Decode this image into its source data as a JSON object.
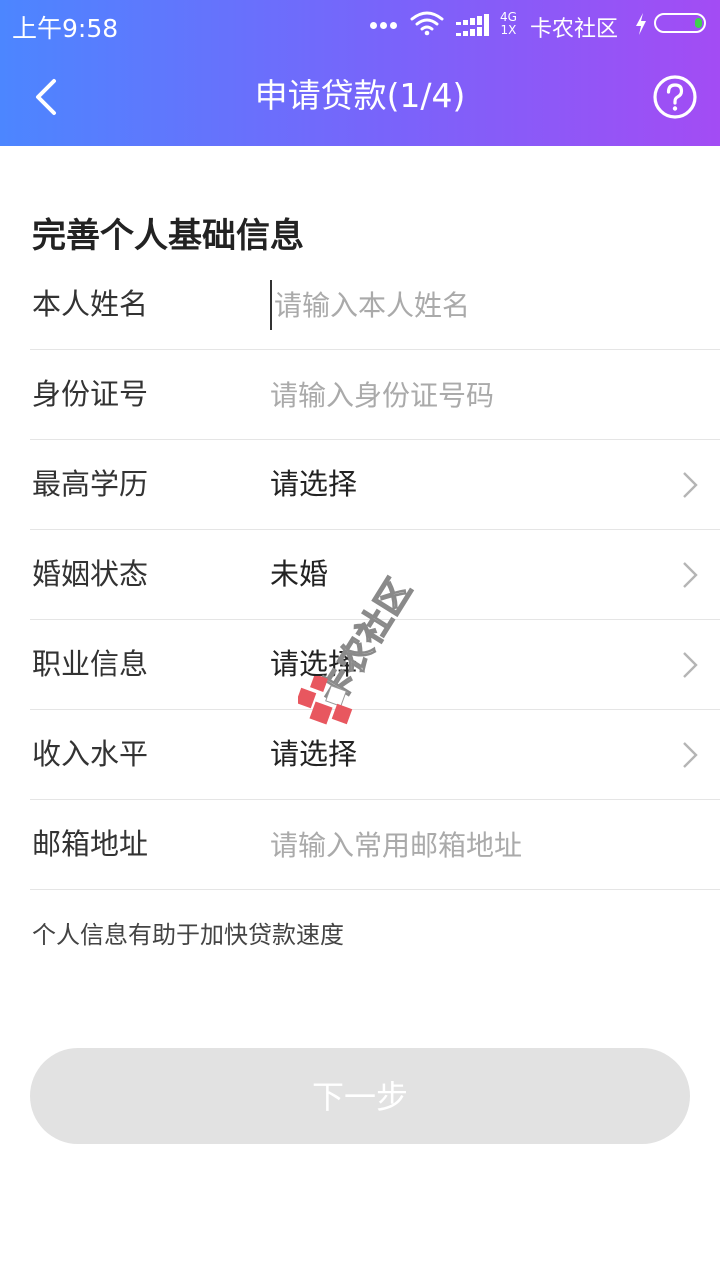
{
  "status_bar": {
    "time": "上午9:58",
    "network_top": "4G",
    "network_bottom": "1X",
    "carrier": "卡农社区",
    "battery_color": "#3ed04d"
  },
  "header": {
    "title": "申请贷款(1/4)",
    "back_icon": "chevron-left-icon",
    "help_icon": "question-circle-icon",
    "gradient": [
      "#4c86ff",
      "#a34cf4"
    ]
  },
  "section": {
    "title": "完善个人基础信息"
  },
  "form": {
    "name": {
      "label": "本人姓名",
      "placeholder": "请输入本人姓名"
    },
    "id_number": {
      "label": "身份证号",
      "placeholder": "请输入身份证号码"
    },
    "education": {
      "label": "最高学历",
      "value": "请选择"
    },
    "marital": {
      "label": "婚姻状态",
      "value": "未婚"
    },
    "occupation": {
      "label": "职业信息",
      "value": "请选择"
    },
    "income": {
      "label": "收入水平",
      "value": "请选择"
    },
    "email": {
      "label": "邮箱地址",
      "placeholder": "请输入常用邮箱地址"
    }
  },
  "hint": "个人信息有助于加快贷款速度",
  "next_button": {
    "label": "下一步",
    "background": "#e2e2e2"
  },
  "watermark": {
    "text": "卡农社区",
    "logo_color": "#e8575f"
  }
}
